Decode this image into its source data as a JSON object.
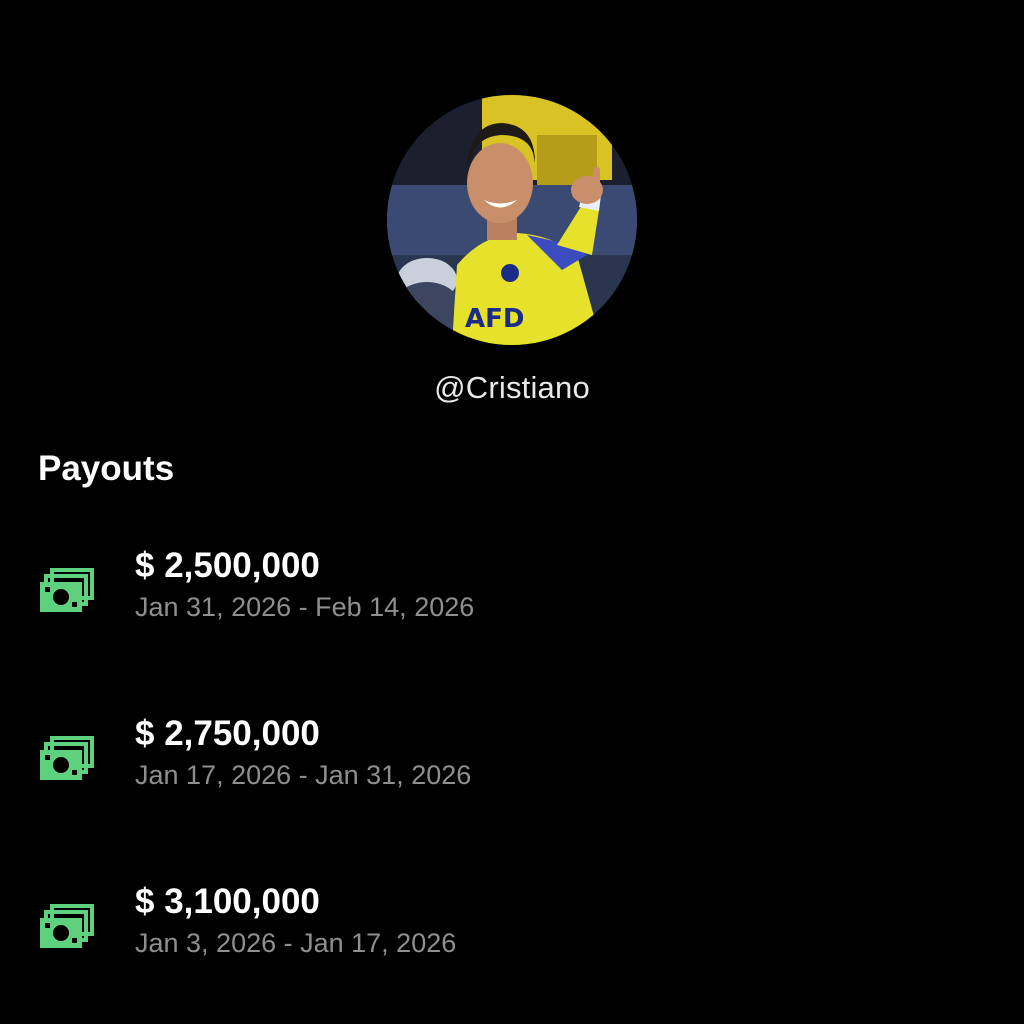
{
  "profile": {
    "handle": "@Cristiano",
    "avatar_icon": "profile-photo"
  },
  "payouts": {
    "title": "Payouts",
    "icon": "money-icon",
    "accent_color": "#5ed17f",
    "items": [
      {
        "amount": "$ 2,500,000",
        "period": "Jan 31, 2026 - Feb 14, 2026"
      },
      {
        "amount": "$ 2,750,000",
        "period": "Jan 17, 2026 - Jan 31, 2026"
      },
      {
        "amount": "$ 3,100,000",
        "period": "Jan 3, 2026 - Jan 17, 2026"
      }
    ]
  }
}
